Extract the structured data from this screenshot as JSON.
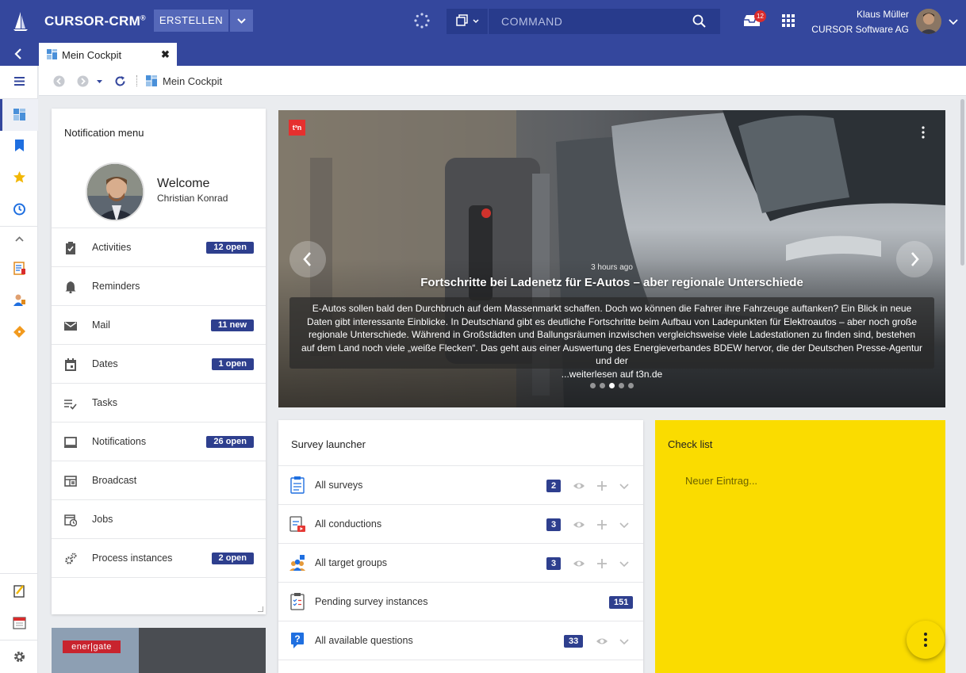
{
  "app": {
    "brand": "CURSOR-CRM",
    "brand_mark": "®",
    "create_label": "ERSTELLEN",
    "command_placeholder": "COMMAND",
    "inbox_count": "12",
    "user_name": "Klaus Müller",
    "user_company": "CURSOR Software AG",
    "accent_color": "#34479d"
  },
  "tabs": [
    {
      "label": "Mein Cockpit",
      "close": "✖"
    }
  ],
  "breadcrumb": {
    "page": "Mein Cockpit"
  },
  "notification_menu": {
    "title": "Notification menu",
    "welcome": "Welcome",
    "user": "Christian Konrad",
    "items": [
      {
        "label": "Activities",
        "badge": "12 open",
        "icon": "clipboard-check-icon"
      },
      {
        "label": "Reminders",
        "badge": "",
        "icon": "bell-icon"
      },
      {
        "label": "Mail",
        "badge": "11 new",
        "icon": "mail-icon"
      },
      {
        "label": "Dates",
        "badge": "1 open",
        "icon": "calendar-icon"
      },
      {
        "label": "Tasks",
        "badge": "",
        "icon": "task-list-icon"
      },
      {
        "label": "Notifications",
        "badge": "26 open",
        "icon": "monitor-icon"
      },
      {
        "label": "Broadcast",
        "badge": "",
        "icon": "broadcast-icon"
      },
      {
        "label": "Jobs",
        "badge": "",
        "icon": "calendar-clock-icon"
      },
      {
        "label": "Process instances",
        "badge": "2 open",
        "icon": "gears-icon"
      }
    ]
  },
  "energate": {
    "logo": "ener|gate"
  },
  "news": {
    "source": "t³n",
    "time": "3 hours ago",
    "headline": "Fortschritte bei Ladenetz für E-Autos – aber regionale Unterschiede",
    "body": "E-Autos sollen bald den Durchbruch auf dem Massenmarkt schaffen. Doch wo können die Fahrer ihre Fahrzeuge auftanken? Ein Blick in neue Daten gibt interessante Einblicke. In Deutschland gibt es deutliche Fortschritte beim Aufbau von Ladepunkten für Elektroautos – aber noch große regionale Unterschiede. Während in Großstädten und Ballungsräumen inzwischen vergleichsweise viele Ladestationen zu finden sind, bestehen auf dem Land noch viele „weiße Flecken“. Das geht aus einer Auswertung des Energieverbandes BDEW hervor, die der Deutschen Presse-Agentur und der",
    "read_more": "...weiterlesen auf t3n.de",
    "slides_total": 5,
    "slide_active": 3
  },
  "survey_launcher": {
    "title": "Survey launcher",
    "items": [
      {
        "label": "All surveys",
        "count": "2",
        "view": true,
        "add": true,
        "expand": true
      },
      {
        "label": "All conductions",
        "count": "3",
        "view": true,
        "add": true,
        "expand": true
      },
      {
        "label": "All target groups",
        "count": "3",
        "view": true,
        "add": true,
        "expand": true
      },
      {
        "label": "Pending survey instances",
        "count": "151",
        "view": false,
        "add": false,
        "expand": false
      },
      {
        "label": "All available questions",
        "count": "33",
        "view": true,
        "add": false,
        "expand": true
      }
    ]
  },
  "checklist": {
    "title": "Check list",
    "placeholder": "Neuer Eintrag...",
    "color": "#fadc00"
  }
}
